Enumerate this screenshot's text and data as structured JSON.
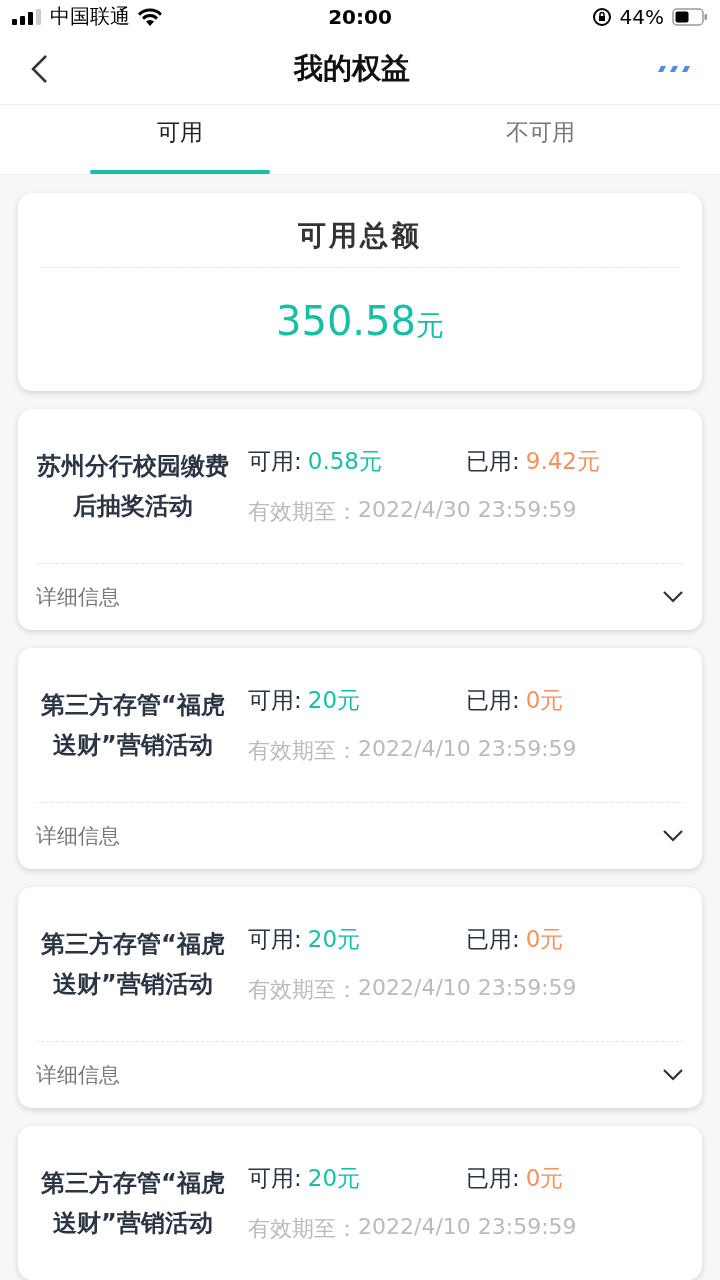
{
  "status_bar": {
    "carrier": "中国联通",
    "time": "20:00",
    "battery": "44%"
  },
  "nav": {
    "title": "我的权益"
  },
  "tabs": [
    {
      "label": "可用",
      "selected": true
    },
    {
      "label": "不可用",
      "selected": false
    }
  ],
  "summary": {
    "title": "可用总额",
    "amount": "350.58",
    "unit": "元"
  },
  "benefits": [
    {
      "name": "苏州分行校园缴费后抽奖活动",
      "available_label": "可用:",
      "available": "0.58元",
      "used_label": "已用:",
      "used": "9.42元",
      "expiry_label": "有效期至：",
      "expiry": "2022/4/30 23:59:59",
      "details": "详细信息",
      "expanded": false
    },
    {
      "name": "第三方存管“福虎送财”营销活动",
      "available_label": "可用:",
      "available": "20元",
      "used_label": "已用:",
      "used": "0元",
      "expiry_label": "有效期至：",
      "expiry": "2022/4/10 23:59:59",
      "details": "详细信息",
      "expanded": false
    },
    {
      "name": "第三方存管“福虎送财”营销活动",
      "available_label": "可用:",
      "available": "20元",
      "used_label": "已用:",
      "used": "0元",
      "expiry_label": "有效期至：",
      "expiry": "2022/4/10 23:59:59",
      "details": "详细信息",
      "expanded": false
    },
    {
      "name": "第三方存管“福虎送财”营销活动",
      "available_label": "可用:",
      "available": "20元",
      "used_label": "已用:",
      "used": "0元",
      "expiry_label": "有效期至：",
      "expiry": "2022/4/10 23:59:59"
    }
  ]
}
